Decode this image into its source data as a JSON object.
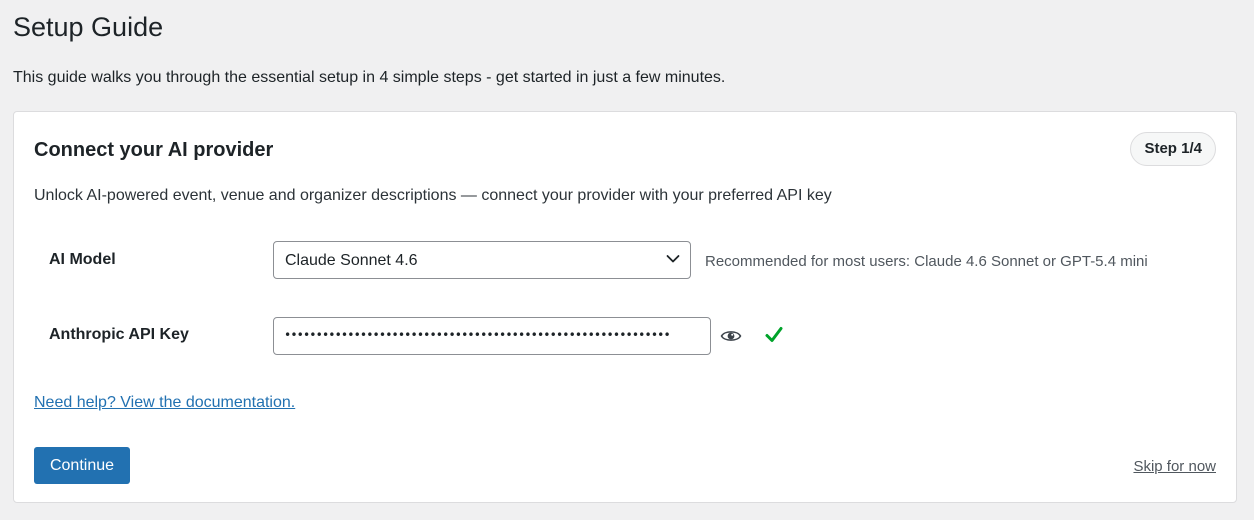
{
  "page": {
    "title": "Setup Guide",
    "intro": "This guide walks you through the essential setup in 4 simple steps - get started in just a few minutes."
  },
  "card": {
    "title": "Connect your AI provider",
    "step_badge": "Step 1/4",
    "description": "Unlock AI-powered event, venue and organizer descriptions — connect your provider with your preferred API key"
  },
  "fields": {
    "model": {
      "label": "AI Model",
      "selected": "Claude Sonnet 4.6",
      "hint": "Recommended for most users: Claude 4.6 Sonnet or GPT-5.4 mini",
      "icon": "chevron-down-icon"
    },
    "api_key": {
      "label": "Anthropic API Key",
      "masked_value": "•••••••••••••••••••••••••••••••••••••••••••••••••••••••••••••",
      "toggle_icon": "eye-icon",
      "status_icon": "checkmark-icon",
      "status": "valid"
    }
  },
  "links": {
    "help": "Need help? View the documentation.",
    "skip": "Skip for now"
  },
  "actions": {
    "continue_label": "Continue"
  },
  "colors": {
    "background": "#f0f0f1",
    "card": "#ffffff",
    "primary": "#2271b1",
    "success": "#00a32a",
    "text": "#1d2327",
    "muted": "#50575e",
    "border": "#8c8f94"
  }
}
